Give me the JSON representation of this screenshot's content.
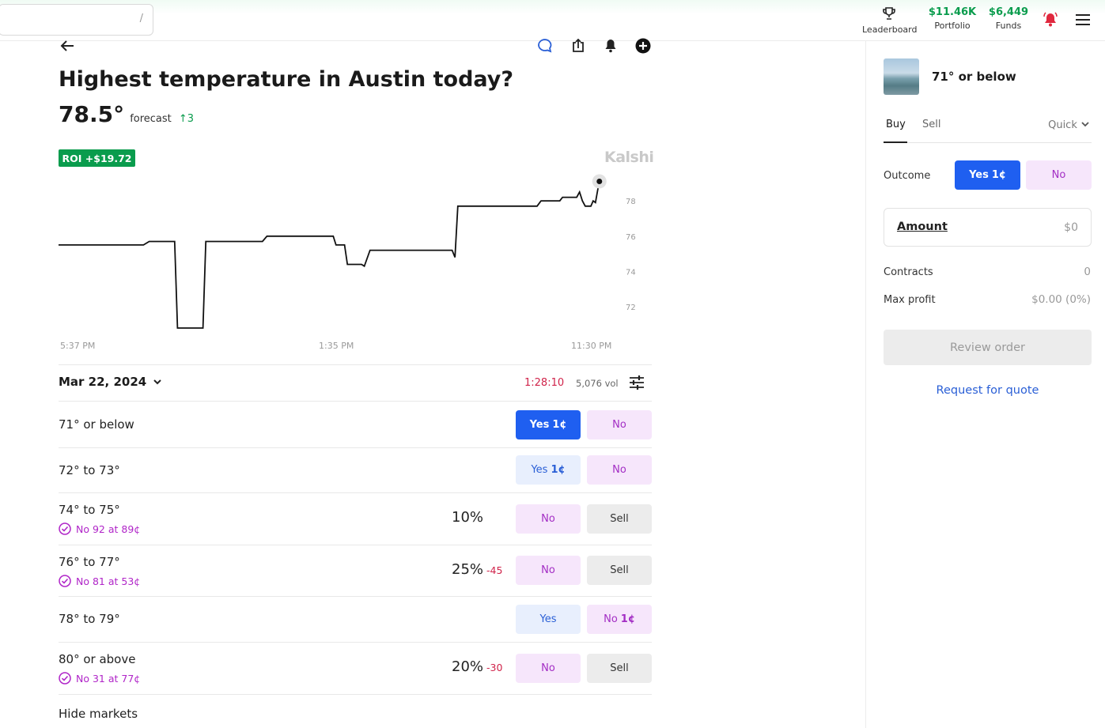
{
  "topbar": {
    "search_hint": "/",
    "leaderboard_label": "Leaderboard",
    "portfolio_value": "$11.46K",
    "portfolio_label": "Portfolio",
    "funds_value": "$6,449",
    "funds_label": "Funds"
  },
  "market": {
    "title": "Highest temperature in Austin today?",
    "forecast_value": "78.5°",
    "forecast_label": "forecast",
    "forecast_change": "↑3",
    "roi": "ROI +$19.72",
    "brand": "Kalshi"
  },
  "chart_data": {
    "type": "line",
    "x_tick_labels": [
      "5:37 PM",
      "1:35 PM",
      "11:30 PM"
    ],
    "y_ticks": [
      72,
      74,
      76,
      78
    ],
    "ylim": [
      70.8,
      79.3
    ],
    "series": [
      {
        "values": [
          [
            0,
            75.5
          ],
          [
            15,
            75.5
          ],
          [
            16,
            75.7
          ],
          [
            20.5,
            75.7
          ],
          [
            21,
            70.8
          ],
          [
            25.5,
            70.8
          ],
          [
            26,
            75.7
          ],
          [
            36,
            75.7
          ],
          [
            36.8,
            76.0
          ],
          [
            48.5,
            76.0
          ],
          [
            49,
            75.5
          ],
          [
            50.5,
            75.5
          ],
          [
            51,
            74.4
          ],
          [
            53.5,
            74.4
          ],
          [
            54,
            74.3
          ],
          [
            55,
            75.2
          ],
          [
            69.5,
            75.2
          ],
          [
            70,
            74.8
          ],
          [
            70.5,
            77.7
          ],
          [
            84.5,
            77.7
          ],
          [
            85.2,
            78.0
          ],
          [
            88.5,
            78.0
          ],
          [
            89,
            78.2
          ],
          [
            91.5,
            78.2
          ],
          [
            92,
            78.5
          ],
          [
            92.5,
            78.0
          ],
          [
            93,
            77.7
          ],
          [
            94,
            77.7
          ],
          [
            94.4,
            78.0
          ],
          [
            94.8,
            77.9
          ],
          [
            95.2,
            78.6
          ],
          [
            95.5,
            79.1
          ]
        ]
      }
    ],
    "colors": {
      "line": "#111111",
      "grid": "#ffffff"
    }
  },
  "markets": {
    "date": "Mar 22, 2024",
    "timer": "1:28:10",
    "volume": "5,076 vol",
    "rows": [
      {
        "label": "71° or below",
        "sub": "",
        "pct": "",
        "chg": "",
        "btn1": "Yes",
        "btn1_price": "1¢",
        "btn2": "No",
        "btn2_price": ""
      },
      {
        "label": "72° to 73°",
        "sub": "",
        "pct": "",
        "chg": "",
        "btn1": "Yes",
        "btn1_price": "1¢",
        "btn2": "No",
        "btn2_price": ""
      },
      {
        "label": "74° to 75°",
        "sub": "No 92 at 89¢",
        "pct": "10%",
        "chg": "",
        "btn1": "No",
        "btn1_price": "",
        "btn2": "Sell",
        "btn2_price": ""
      },
      {
        "label": "76° to 77°",
        "sub": "No 81 at 53¢",
        "pct": "25%",
        "chg": "-45",
        "btn1": "No",
        "btn1_price": "",
        "btn2": "Sell",
        "btn2_price": ""
      },
      {
        "label": "78° to 79°",
        "sub": "",
        "pct": "",
        "chg": "",
        "btn1": "Yes",
        "btn1_price": "",
        "btn2": "No",
        "btn2_price": "1¢"
      },
      {
        "label": "80° or above",
        "sub": "No 31 at 77¢",
        "pct": "20%",
        "chg": "-30",
        "btn1": "No",
        "btn1_price": "",
        "btn2": "Sell",
        "btn2_price": ""
      }
    ],
    "hide_label": "Hide markets"
  },
  "panel": {
    "title": "71° or below",
    "tab_buy": "Buy",
    "tab_sell": "Sell",
    "mode": "Quick",
    "outcome_label": "Outcome",
    "outcome_yes": "Yes",
    "outcome_yes_price": "1¢",
    "outcome_no": "No",
    "amount_label": "Amount",
    "amount_value": "$0",
    "contracts_label": "Contracts",
    "contracts_value": "0",
    "max_profit_label": "Max profit",
    "max_profit_value": "$0.00 (0%)",
    "review_label": "Review order",
    "rfq_label": "Request for quote"
  }
}
